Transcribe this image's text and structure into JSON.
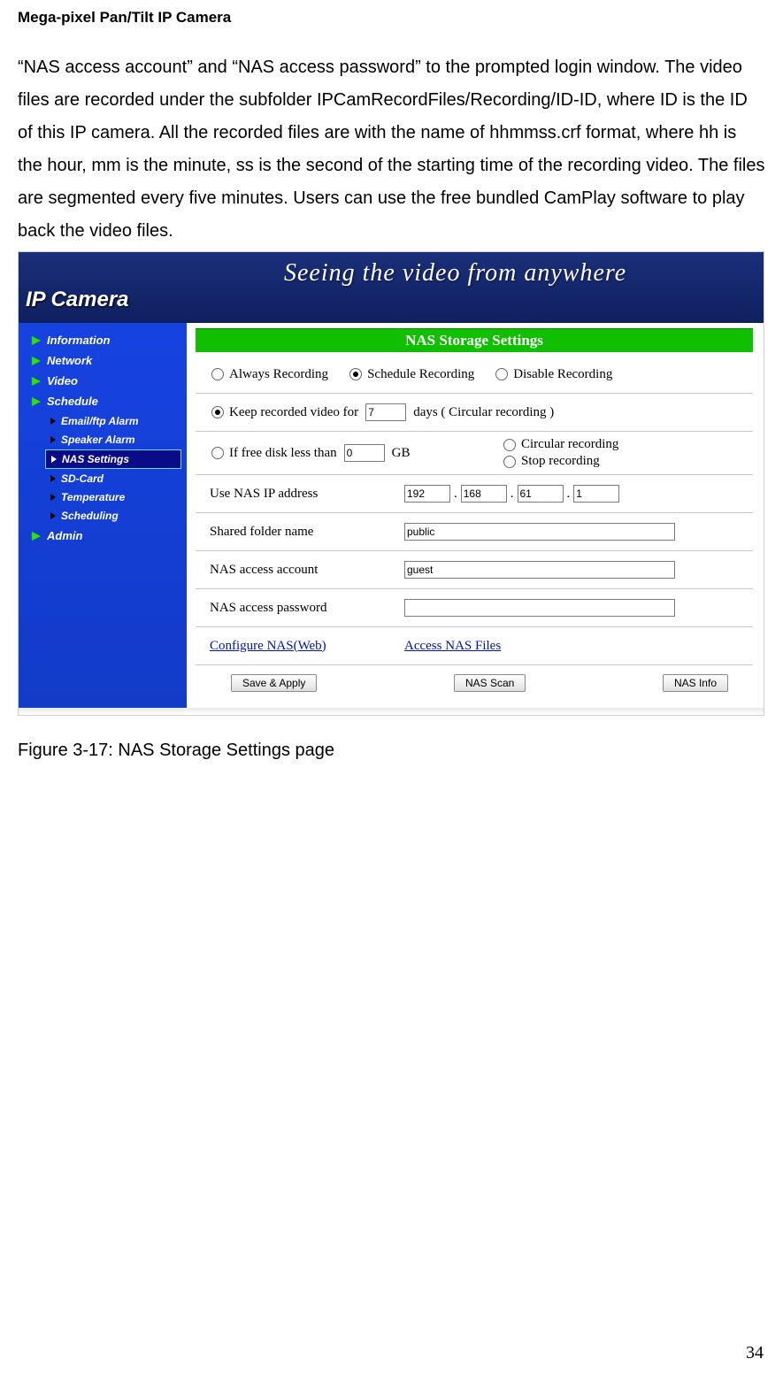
{
  "doc_header": "Mega-pixel Pan/Tilt IP Camera",
  "body_text": "“NAS access account” and “NAS access password” to the prompted login window. The video files are recorded under the subfolder IPCamRecordFiles/Recording/ID-ID, where ID is the ID of this IP camera. All the recorded files are with the name of hhmmss.crf format, where hh is the hour, mm is the minute, ss is the second of the starting time of the recording video. The files are segmented every five minutes. Users can use the free bundled CamPlay software to play back the video files.",
  "figure_caption": "Figure 3-17: NAS Storage Settings page",
  "page_number": "34",
  "banner": {
    "logo": "IP Camera",
    "script": "Seeing the video from anywhere",
    "sub": ""
  },
  "sidebar": {
    "main": [
      "Information",
      "Network",
      "Video",
      "Schedule"
    ],
    "sub": [
      "Email/ftp Alarm",
      "Speaker Alarm",
      "NAS Settings",
      "SD-Card",
      "Temperature",
      "Scheduling"
    ],
    "selected_sub_index": 2,
    "footer": "Admin"
  },
  "settings": {
    "title": "NAS Storage Settings",
    "rec_mode": {
      "options": [
        "Always Recording",
        "Schedule Recording",
        "Disable Recording"
      ],
      "checked_index": 1
    },
    "keep": {
      "pre": "Keep recorded video for",
      "value": "7",
      "post": "days ( Circular recording )",
      "checked": true
    },
    "freedisk": {
      "pre": "If free disk less than",
      "value": "0",
      "post": "GB",
      "checked": false,
      "actions": [
        "Circular recording",
        "Stop recording"
      ],
      "action_checked_index": -1
    },
    "ip": {
      "label": "Use NAS IP address",
      "a": "192",
      "b": "168",
      "c": "61",
      "d": "1"
    },
    "folder": {
      "label": "Shared folder name",
      "value": "public"
    },
    "account": {
      "label": "NAS access account",
      "value": "guest"
    },
    "password": {
      "label": "NAS access password",
      "value": ""
    },
    "links": {
      "configure": "Configure NAS(Web)",
      "access": "Access NAS Files"
    },
    "buttons": {
      "save": "Save & Apply",
      "scan": "NAS Scan",
      "info": "NAS Info"
    }
  }
}
